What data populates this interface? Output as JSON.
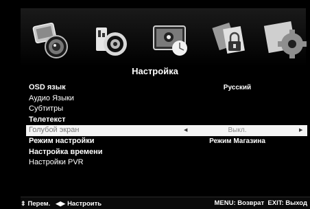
{
  "title": "Настройка",
  "icons": [
    {
      "name": "picture-icon"
    },
    {
      "name": "sound-icon"
    },
    {
      "name": "clock-icon"
    },
    {
      "name": "lock-icon"
    },
    {
      "name": "setup-icon"
    }
  ],
  "menu": [
    {
      "label": "OSD язык",
      "value": "Русский",
      "bold": true
    },
    {
      "label": "Аудио Языки",
      "value": "",
      "bold": false
    },
    {
      "label": "Субтитры",
      "value": "",
      "bold": false
    },
    {
      "label": "Телетекст",
      "value": "",
      "bold": true
    },
    {
      "label": "Голубой экран",
      "value": "Выкл.",
      "bold": false,
      "selected": true
    },
    {
      "label": "Режим настройки",
      "value": "Режим Магазина",
      "bold": true
    },
    {
      "label": "Настройка времени",
      "value": "",
      "bold": true
    },
    {
      "label": "Настройки PVR",
      "value": "",
      "bold": false
    }
  ],
  "footer": {
    "move": "Перем.",
    "adjust": "Настроить",
    "menu_hint": "MENU: Возврат",
    "exit_hint": "EXIT: Выход"
  }
}
